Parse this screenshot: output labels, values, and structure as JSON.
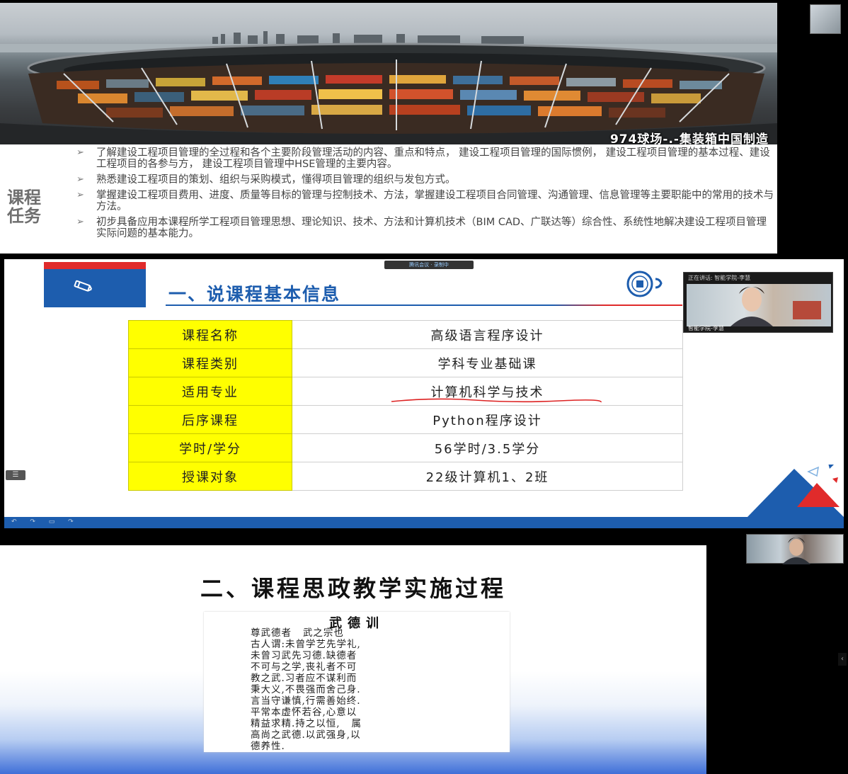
{
  "panel1": {
    "caption": "974球场-.-集装箱中国制造",
    "task_title": "课程\n任务",
    "bullet_glyph": "➢",
    "tasks": [
      "了解建设工程项目管理的全过程和各个主要阶段管理活动的内容、重点和特点， 建设工程项目管理的国际惯例， 建设工程项目管理的基本过程、建设工程项目的各参与方， 建设工程项目管理中HSE管理的主要内容。",
      "熟悉建设工程项目的策划、组织与采购模式，懂得项目管理的组织与发包方式。",
      "掌握建设工程项目费用、进度、质量等目标的管理与控制技术、方法，掌握建设工程项目合同管理、沟通管理、信息管理等主要职能中的常用的技术与方法。",
      "初步具备应用本课程所学工程项目管理思想、理论知识、技术、方法和计算机技术（BIM CAD、广联达等）综合性、系统性地解决建设工程项目管理实际问题的基本能力。"
    ]
  },
  "panel2": {
    "topbar": "腾讯会议 · 录制中",
    "title": "一、说课程基本信息",
    "rows": [
      {
        "key": "课程名称",
        "value": "高级语言程序设计"
      },
      {
        "key": "课程类别",
        "value": "学科专业基础课"
      },
      {
        "key": "适用专业",
        "value": "计算机科学与技术"
      },
      {
        "key": "后序课程",
        "value": "Python程序设计"
      },
      {
        "key": "学时/学分",
        "value": "56学时/3.5学分"
      },
      {
        "key": "授课对象",
        "value": "22级计算机1、2班"
      }
    ],
    "video_speaking": "正在讲话: 智能学院-李慧",
    "video_label": "智能学院-李慧",
    "side_handle": "☰",
    "bottom_controls": "↶ ↷ ▭ ↷"
  },
  "panel3": {
    "title": "二、课程思政教学实施过程",
    "card_title": "武德训",
    "card_lines": [
      "尊武德者   武之宗也",
      "古人谓:未曾学艺先学礼,",
      "未曾习武先习德.缺德者",
      "不可与之学,丧礼者不可",
      "教之武.习者应不谋利而",
      "秉大义,不畏强而舍己身.",
      "言当守谦慎,行需善始终.",
      "平常本虚怀若谷,心意以",
      "精益求精.持之以恒,   属",
      "高尚之武德.以武强身,以",
      "德养性."
    ],
    "side_arrow": "‹"
  },
  "colors": {
    "slide_blue": "#1d5dae",
    "slide_red": "#e02b2b",
    "key_yellow": "#ffff00"
  },
  "icons": [
    "pencil-icon",
    "university-seal-icon",
    "menu-icon",
    "chevron-left-icon"
  ]
}
